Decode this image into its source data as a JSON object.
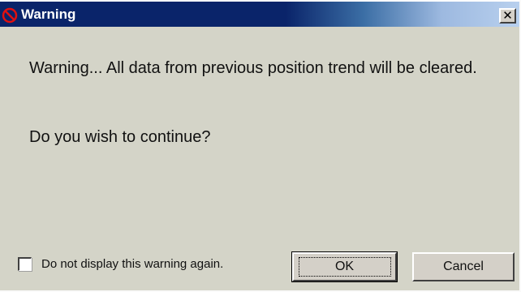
{
  "window": {
    "title": "Warning",
    "close_glyph": "✕"
  },
  "message": {
    "text": "Warning... All data from previous position trend will be cleared.",
    "question": "Do you wish to continue?"
  },
  "checkbox": {
    "label": "Do not display this warning again.",
    "checked": false
  },
  "buttons": {
    "ok_label": "OK",
    "cancel_label": "Cancel"
  },
  "icons": {
    "title_icon": "no-entry-icon",
    "close_icon": "close-icon"
  },
  "colors": {
    "titlebar": "#0a246a",
    "dialog_bg": "#d4d4c8",
    "icon_red": "#e01010"
  }
}
